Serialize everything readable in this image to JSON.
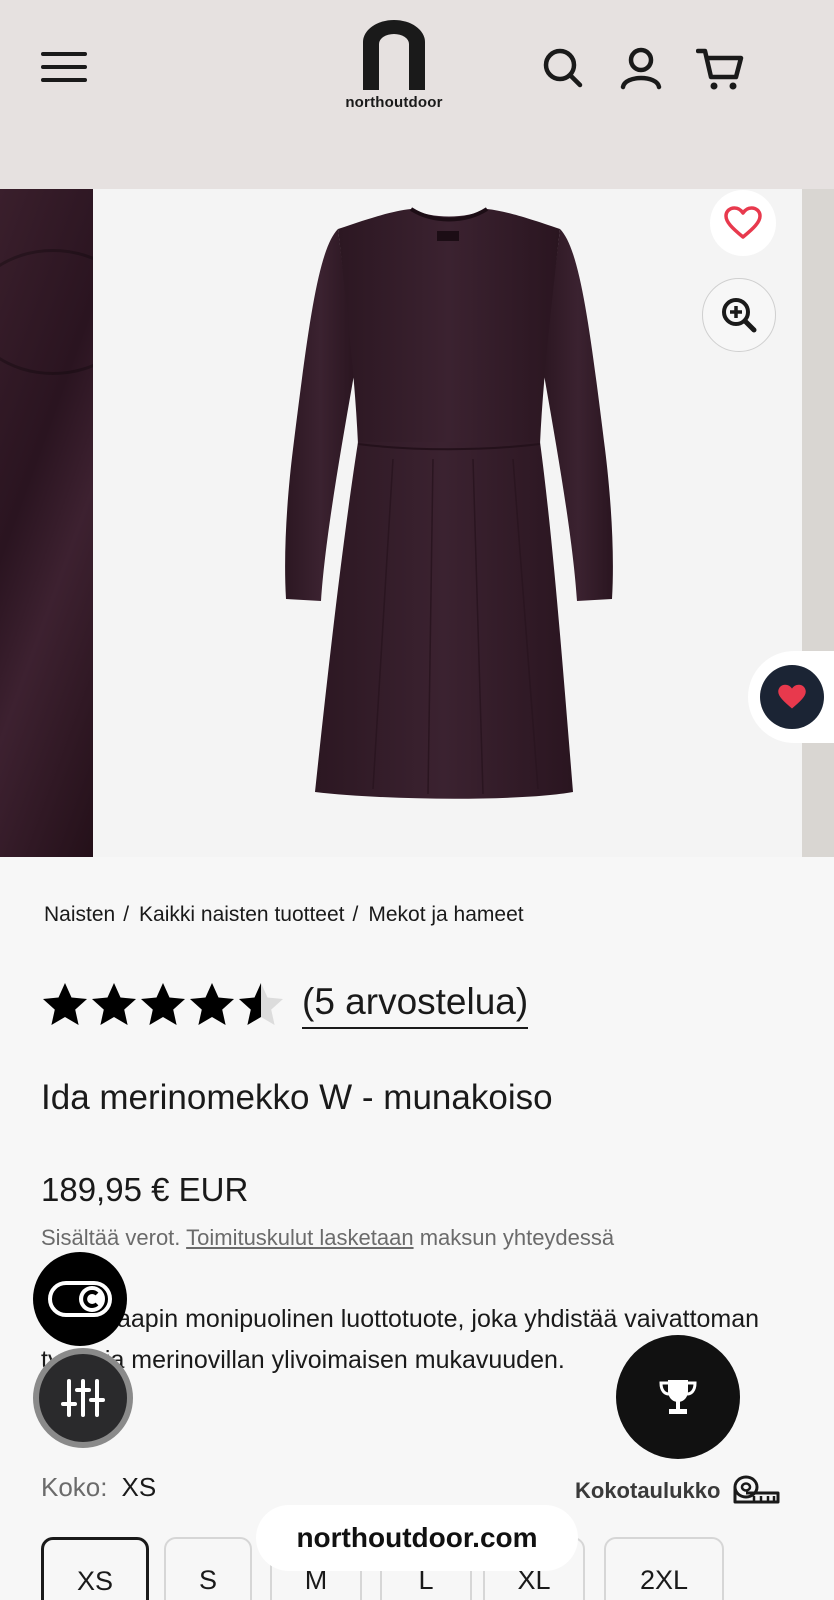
{
  "header": {
    "logo_text": "northoutdoor",
    "icons": [
      "menu-icon",
      "search-icon",
      "account-icon",
      "cart-icon"
    ]
  },
  "gallery": {
    "icons": [
      "heart-outline-icon",
      "zoom-in-icon",
      "heart-icon"
    ]
  },
  "breadcrumb": {
    "items": [
      "Naisten",
      "Kaikki naisten tuotteet",
      "Mekot ja hameet"
    ],
    "separator": "/"
  },
  "rating": {
    "value": 4.5,
    "max": 5,
    "reviews_label": "(5 arvostelua)"
  },
  "product": {
    "title": "Ida merinomekko W - munakoiso",
    "price": "189,95 € EUR",
    "tax_prefix": "Sisältää verot.",
    "tax_link": "Toimituskulut lasketaan",
    "tax_suffix": "maksun yhteydessä",
    "description": "Vaatekaapin monipuolinen luottotuote, joka yhdistää vaivattoman tyylin ja merinovillan ylivoimaisen mukavuuden."
  },
  "size": {
    "label": "Koko:",
    "selected": "XS",
    "chart_label": "Kokotaulukko",
    "options": [
      "XS",
      "S",
      "M",
      "L",
      "XL",
      "2XL"
    ]
  },
  "overlay": {
    "domain": "northoutdoor.com",
    "icons": [
      "toggle-icon",
      "filter-sliders-icon",
      "trophy-icon"
    ]
  },
  "colors": {
    "header_bg": "#e6e1e0",
    "page_bg": "#f7f7f7",
    "heart_red": "#e8394d",
    "dress": "#3b2230"
  }
}
